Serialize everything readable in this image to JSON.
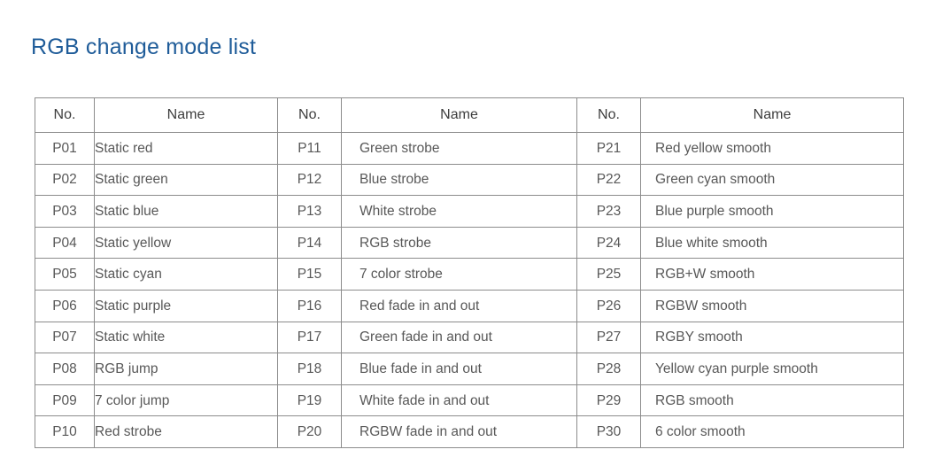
{
  "page": {
    "title": "RGB change mode list",
    "title_color": "#1f5c99",
    "background_color": "#ffffff",
    "text_color": "#585858",
    "border_color": "#8c8c8c"
  },
  "table": {
    "headers": [
      "No.",
      "Name",
      "No.",
      "Name",
      "No.",
      "Name"
    ],
    "rows": [
      [
        "P01",
        "Static red",
        "P11",
        "Green strobe",
        "P21",
        "Red yellow smooth"
      ],
      [
        "P02",
        "Static green",
        "P12",
        "Blue strobe",
        "P22",
        "Green cyan smooth"
      ],
      [
        "P03",
        "Static blue",
        "P13",
        "White strobe",
        "P23",
        "Blue purple smooth"
      ],
      [
        "P04",
        "Static yellow",
        "P14",
        "RGB strobe",
        "P24",
        "Blue white smooth"
      ],
      [
        "P05",
        "Static cyan",
        "P15",
        "7 color strobe",
        "P25",
        "RGB+W smooth"
      ],
      [
        "P06",
        "Static purple",
        "P16",
        "Red fade in and out",
        "P26",
        "RGBW smooth"
      ],
      [
        "P07",
        "Static white",
        "P17",
        "Green fade in and out",
        "P27",
        "RGBY smooth"
      ],
      [
        "P08",
        "RGB jump",
        "P18",
        "Blue fade in and out",
        "P28",
        "Yellow cyan purple smooth"
      ],
      [
        "P09",
        "7 color jump",
        "P19",
        "White fade in and out",
        "P29",
        "RGB smooth"
      ],
      [
        "P10",
        "Red strobe",
        "P20",
        "RGBW fade in and out",
        "P30",
        "6 color smooth"
      ]
    ]
  }
}
